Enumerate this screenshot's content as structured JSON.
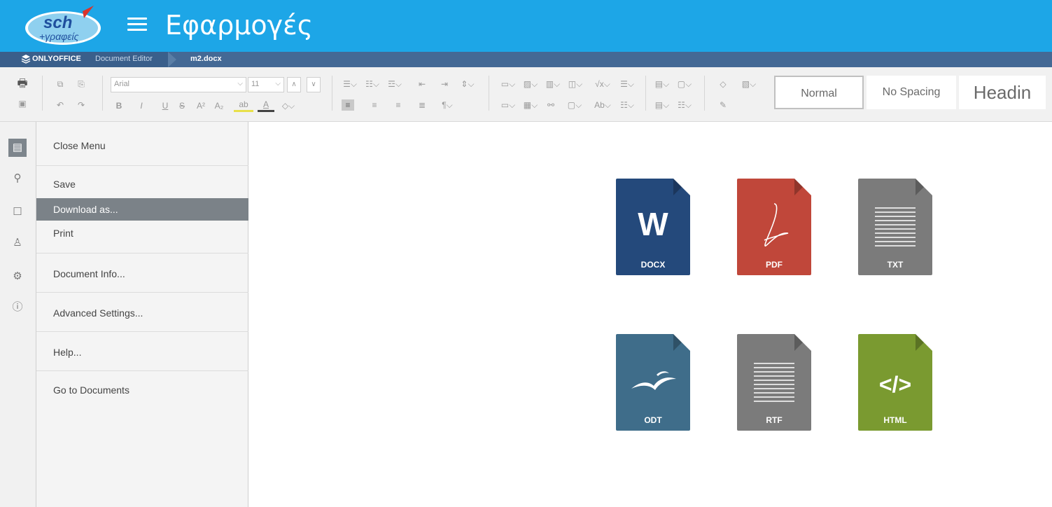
{
  "header": {
    "app_title": "Εφαρμογές",
    "logo_text": "sch",
    "logo_sub": "+γραφείς"
  },
  "editor_bar": {
    "brand": "ONLYOFFICE",
    "product": "Document Editor",
    "document_name": "m2.docx"
  },
  "toolbar": {
    "font_name": "Arial",
    "font_size": "11",
    "styles": [
      "Normal",
      "No Spacing",
      "Headin"
    ],
    "active_style": "Normal"
  },
  "rail": {
    "items": [
      "file-icon",
      "search-icon",
      "comment-icon",
      "user-icon",
      "plugin-icon",
      "info-icon"
    ]
  },
  "file_menu": {
    "items": [
      {
        "label": "Close Menu"
      },
      {
        "label": "Save"
      },
      {
        "label": "Download as..."
      },
      {
        "label": "Print"
      },
      {
        "label": "Document Info..."
      },
      {
        "label": "Advanced Settings..."
      },
      {
        "label": "Help..."
      },
      {
        "label": "Go to Documents"
      }
    ],
    "selected": "Download as..."
  },
  "download_formats": [
    {
      "label": "DOCX",
      "color": "#24497b",
      "glyph": "W"
    },
    {
      "label": "PDF",
      "color": "#c0473a",
      "glyph": "pdf"
    },
    {
      "label": "TXT",
      "color": "#7b7b7b",
      "glyph": "lines"
    },
    {
      "label": "ODT",
      "color": "#3f6d8a",
      "glyph": "gulls"
    },
    {
      "label": "RTF",
      "color": "#7b7b7b",
      "glyph": "lines"
    },
    {
      "label": "HTML",
      "color": "#7a9a30",
      "glyph": "</>"
    }
  ],
  "colors": {
    "appbar": "#1da6e7",
    "editorbar": "#446995",
    "selected_item": "#7b8288"
  }
}
